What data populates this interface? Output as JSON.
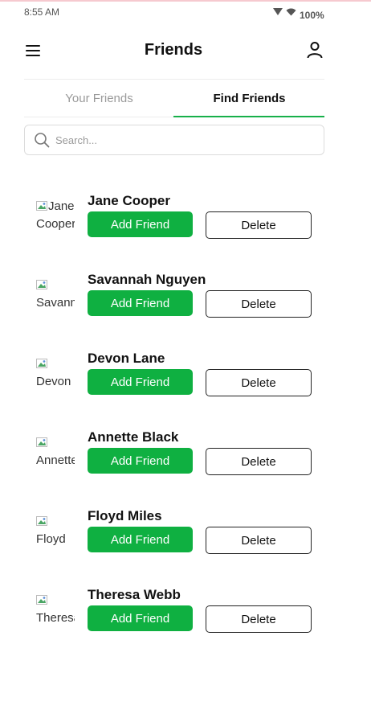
{
  "status_bar": {
    "time": "8:55 AM",
    "battery": "100%"
  },
  "header": {
    "title": "Friends"
  },
  "tabs": [
    {
      "label": "Your Friends",
      "active": false
    },
    {
      "label": "Find Friends",
      "active": true
    }
  ],
  "search": {
    "placeholder": "Search..."
  },
  "colors": {
    "accent": "#17b04a",
    "add_button": "#0fb041"
  },
  "icons": {
    "menu": "hamburger-icon",
    "profile": "user-icon",
    "search": "search-icon",
    "wifi": "wifi-icon",
    "signal": "signal-icon"
  },
  "friends": [
    {
      "name": "Jane Cooper",
      "avatar_alt": "Jane Cooper",
      "add_label": "Add Friend",
      "delete_label": "Delete"
    },
    {
      "name": "Savannah Nguyen",
      "avatar_alt": "Savannah Nguyen",
      "add_label": "Add Friend",
      "delete_label": "Delete"
    },
    {
      "name": "Devon Lane",
      "avatar_alt": "Devon Lane",
      "add_label": "Add Friend",
      "delete_label": "Delete"
    },
    {
      "name": "Annette Black",
      "avatar_alt": "Annette Black",
      "add_label": "Add Friend",
      "delete_label": "Delete"
    },
    {
      "name": "Floyd Miles",
      "avatar_alt": "Floyd Miles",
      "add_label": "Add Friend",
      "delete_label": "Delete"
    },
    {
      "name": "Theresa Webb",
      "avatar_alt": "Theresa Webb",
      "add_label": "Add Friend",
      "delete_label": "Delete"
    }
  ]
}
